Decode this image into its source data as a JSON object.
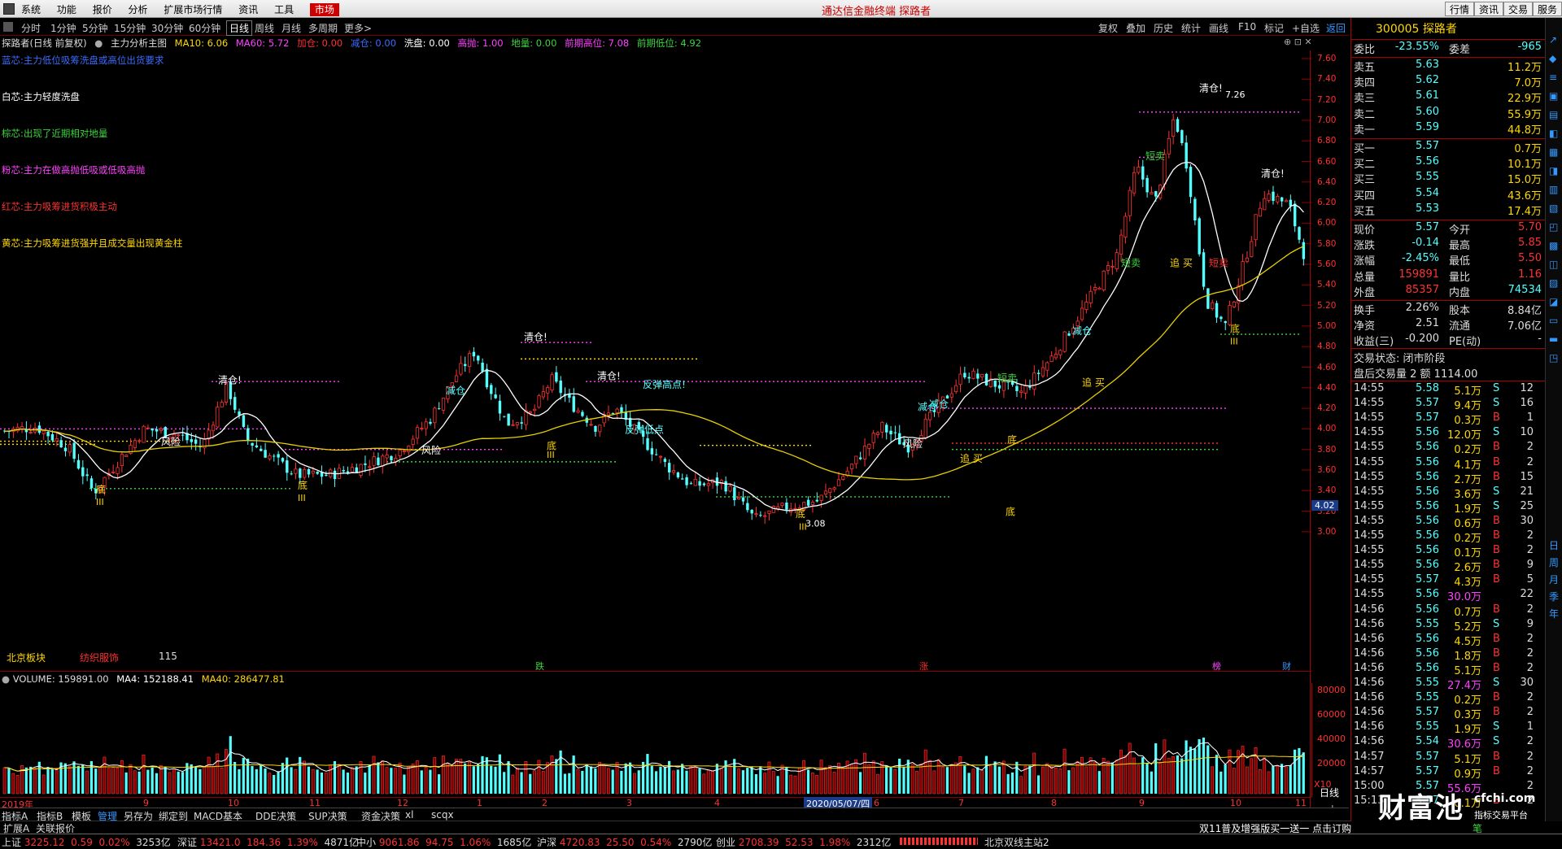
{
  "titlebar": {
    "menu": [
      "系统",
      "功能",
      "报价",
      "分析",
      "扩展市场行情",
      "资讯",
      "工具",
      "市场"
    ],
    "center_title": "通达信金融终端 探路者",
    "right_buttons": [
      "行情",
      "资讯",
      "交易",
      "服务"
    ]
  },
  "toolbar": {
    "periods": [
      "分时",
      "1分钟",
      "5分钟",
      "15分钟",
      "30分钟",
      "60分钟",
      "日线",
      "周线",
      "月线",
      "多周期",
      "更多>"
    ],
    "active_period": "日线",
    "right_tools": [
      "复权",
      "叠加",
      "历史",
      "统计",
      "画线",
      "F10",
      "标记",
      "+自选",
      "返回"
    ]
  },
  "infoline": {
    "stock": "探路者(日线 前复权)",
    "indicator": "主力分析主图",
    "ma10": "MA10: 6.06",
    "ma60": "MA60: 5.72",
    "jiacang": "加仓: 0.00",
    "jiancang": "减仓: 0.00",
    "xipan": "洗盘: 0.00",
    "gaopao": "高抛: 1.00",
    "diliang": "地量: 0.00",
    "prev_high": "前期高位: 7.08",
    "prev_low": "前期低位: 4.92"
  },
  "legend": [
    {
      "text": "蓝芯:主力低位吸筹洗盘或高位出货要求",
      "color": "#3a6bff"
    },
    {
      "text": "白芯:主力轻度洗盘",
      "color": "#ffffff"
    },
    {
      "text": "棕芯:出现了近期相对地量",
      "color": "#3cd43c"
    },
    {
      "text": "粉芯:主力在做高抛低吸或低吸高抛",
      "color": "#ff40ff"
    },
    {
      "text": "红芯:主力吸筹进货积极主动",
      "color": "#ff3030"
    },
    {
      "text": "黄芯:主力吸筹进货强并且成交量出现黄金柱",
      "color": "#ffd800"
    }
  ],
  "chart_axis": {
    "price_ticks": [
      "7.60",
      "7.40",
      "7.20",
      "7.00",
      "6.80",
      "6.60",
      "6.40",
      "6.20",
      "6.00",
      "5.80",
      "5.60",
      "5.40",
      "5.20",
      "5.00",
      "4.80",
      "4.60",
      "4.40",
      "4.20",
      "4.00",
      "3.80",
      "3.60",
      "3.40",
      "3.20",
      "3.00"
    ],
    "current_price_tag": "4.02",
    "volume_ticks": [
      "80000",
      "60000",
      "40000",
      "20000",
      "X10"
    ],
    "month_labels": [
      "2019年",
      "9",
      "10",
      "11",
      "12",
      "1",
      "2",
      "3",
      "4",
      "5",
      "6",
      "7",
      "8",
      "9",
      "10",
      "11"
    ],
    "date_tag": "2020/05/07/四"
  },
  "chart_annotations": {
    "qingcang": [
      "清仓!",
      "清仓!",
      "清仓!",
      "清仓!",
      "清仓!"
    ],
    "high_label": "7.26",
    "low_label": "3.08",
    "di": [
      "底",
      "底",
      "底",
      "底",
      "底",
      "底",
      "底"
    ],
    "fanfeng": [
      "反弹高点!",
      "反弹低点"
    ],
    "jiancang": [
      "减仓",
      "减仓",
      "减仓",
      "减仓"
    ],
    "fengxian": [
      "风险",
      "风险",
      "风险"
    ],
    "zhuimai": [
      "追 买",
      "追 买",
      "追 买"
    ],
    "duanmai": [
      "短卖",
      "短卖",
      "短卖",
      "短卖"
    ],
    "roman": [
      "III",
      "III",
      "III",
      "III",
      "III"
    ]
  },
  "event_markers": [
    "跌",
    "涨",
    "榜",
    "财"
  ],
  "sector_row": {
    "a": "北京板块",
    "b": "纺织服饰",
    "c": "115"
  },
  "volume_line": {
    "title": "VOLUME: 159891.00",
    "ma4": "MA4: 152188.41",
    "ma40": "MA40: 286477.81"
  },
  "bottom_tabs": [
    "指标A",
    "指标B",
    "模板",
    "管理",
    "另存为",
    "绑定到",
    "MACD基本",
    "DDE决策",
    "SUP决策",
    "资金决策",
    "xl",
    "scqx"
  ],
  "active_tab": "管理",
  "expand_row": [
    "扩展A",
    "关联报价"
  ],
  "right_panel": {
    "code_name": "300005 探路者",
    "weibi": {
      "label": "委比",
      "val": "-23.55%",
      "label2": "委差",
      "val2": "-965"
    },
    "asks": [
      {
        "label": "卖五",
        "price": "5.63",
        "vol": "11.2万"
      },
      {
        "label": "卖四",
        "price": "5.62",
        "vol": "7.0万"
      },
      {
        "label": "卖三",
        "price": "5.61",
        "vol": "22.9万"
      },
      {
        "label": "卖二",
        "price": "5.60",
        "vol": "55.9万"
      },
      {
        "label": "卖一",
        "price": "5.59",
        "vol": "44.8万"
      }
    ],
    "bids": [
      {
        "label": "买一",
        "price": "5.57",
        "vol": "0.7万"
      },
      {
        "label": "买二",
        "price": "5.56",
        "vol": "10.1万"
      },
      {
        "label": "买三",
        "price": "5.55",
        "vol": "15.0万"
      },
      {
        "label": "买四",
        "price": "5.54",
        "vol": "43.6万"
      },
      {
        "label": "买五",
        "price": "5.53",
        "vol": "17.4万"
      }
    ],
    "stats": [
      {
        "l1": "现价",
        "v1": "5.57",
        "l2": "今开",
        "v2": "5.70"
      },
      {
        "l1": "涨跌",
        "v1": "-0.14",
        "l2": "最高",
        "v2": "5.85"
      },
      {
        "l1": "涨幅",
        "v1": "-2.45%",
        "l2": "最低",
        "v2": "5.50"
      },
      {
        "l1": "总量",
        "v1": "159891",
        "l2": "量比",
        "v2": "1.16"
      },
      {
        "l1": "外盘",
        "v1": "85357",
        "l2": "内盘",
        "v2": "74534"
      },
      {
        "l1": "换手",
        "v1": "2.26%",
        "l2": "股本",
        "v2": "8.84亿"
      },
      {
        "l1": "净资",
        "v1": "2.51",
        "l2": "流通",
        "v2": "7.06亿"
      },
      {
        "l1": "收益(三)",
        "v1": "-0.200",
        "l2": "PE(动)",
        "v2": "-"
      }
    ],
    "status": "交易状态: 闭市阶段",
    "after_hours": "盘后交易量 2 额 1114.00",
    "ticks": [
      {
        "t": "14:55",
        "p": "5.58",
        "v": "5.1万",
        "d": "S",
        "n": "12"
      },
      {
        "t": "14:55",
        "p": "5.57",
        "v": "9.4万",
        "d": "S",
        "n": "16"
      },
      {
        "t": "14:55",
        "p": "5.57",
        "v": "0.3万",
        "d": "B",
        "n": "1"
      },
      {
        "t": "14:55",
        "p": "5.56",
        "v": "12.0万",
        "d": "S",
        "n": "10"
      },
      {
        "t": "14:55",
        "p": "5.56",
        "v": "0.2万",
        "d": "B",
        "n": "2"
      },
      {
        "t": "14:55",
        "p": "5.56",
        "v": "4.1万",
        "d": "B",
        "n": "2"
      },
      {
        "t": "14:55",
        "p": "5.56",
        "v": "2.7万",
        "d": "B",
        "n": "15"
      },
      {
        "t": "14:55",
        "p": "5.56",
        "v": "3.6万",
        "d": "S",
        "n": "21"
      },
      {
        "t": "14:55",
        "p": "5.56",
        "v": "1.9万",
        "d": "S",
        "n": "25"
      },
      {
        "t": "14:55",
        "p": "5.56",
        "v": "0.6万",
        "d": "B",
        "n": "30"
      },
      {
        "t": "14:55",
        "p": "5.56",
        "v": "0.2万",
        "d": "B",
        "n": "2"
      },
      {
        "t": "14:55",
        "p": "5.56",
        "v": "0.1万",
        "d": "B",
        "n": "2"
      },
      {
        "t": "14:55",
        "p": "5.56",
        "v": "2.6万",
        "d": "B",
        "n": "9"
      },
      {
        "t": "14:55",
        "p": "5.57",
        "v": "4.3万",
        "d": "B",
        "n": "5"
      },
      {
        "t": "14:55",
        "p": "5.56",
        "v": "30.0万",
        "d": "",
        "n": "22"
      },
      {
        "t": "14:56",
        "p": "5.56",
        "v": "0.7万",
        "d": "B",
        "n": "2"
      },
      {
        "t": "14:56",
        "p": "5.55",
        "v": "5.2万",
        "d": "S",
        "n": "9"
      },
      {
        "t": "14:56",
        "p": "5.56",
        "v": "4.5万",
        "d": "B",
        "n": "2"
      },
      {
        "t": "14:56",
        "p": "5.56",
        "v": "1.8万",
        "d": "B",
        "n": "2"
      },
      {
        "t": "14:56",
        "p": "5.56",
        "v": "5.1万",
        "d": "B",
        "n": "2"
      },
      {
        "t": "14:56",
        "p": "5.55",
        "v": "27.4万",
        "d": "S",
        "n": "30"
      },
      {
        "t": "14:56",
        "p": "5.55",
        "v": "0.2万",
        "d": "B",
        "n": "2"
      },
      {
        "t": "14:56",
        "p": "5.57",
        "v": "0.3万",
        "d": "B",
        "n": "2"
      },
      {
        "t": "14:56",
        "p": "5.55",
        "v": "1.9万",
        "d": "S",
        "n": "1"
      },
      {
        "t": "14:56",
        "p": "5.54",
        "v": "30.6万",
        "d": "S",
        "n": "2"
      },
      {
        "t": "14:57",
        "p": "5.57",
        "v": "5.1万",
        "d": "B",
        "n": "2"
      },
      {
        "t": "14:57",
        "p": "5.57",
        "v": "0.9万",
        "d": "B",
        "n": "2"
      },
      {
        "t": "15:00",
        "p": "5.57",
        "v": "55.6万",
        "d": "",
        "n": "2"
      },
      {
        "t": "15:13",
        "p": "5.57",
        "v": "0.1万",
        "d": "B",
        "n": "2"
      }
    ],
    "side_icons": [
      "日",
      "周",
      "月",
      "季",
      "年"
    ],
    "side_tag": "笔",
    "ad_tag": "指标交易平台"
  },
  "bottom_status": {
    "sh": {
      "label": "上证",
      "value": "3225.12",
      "change": "0.59",
      "pct": "0.02%",
      "amount": "3253亿"
    },
    "sz": {
      "label": "深证",
      "value": "13421.0",
      "change": "184.36",
      "pct": "1.39%",
      "amount": "4871亿"
    },
    "zx": {
      "label": "中小",
      "value": "9061.86",
      "change": "94.75",
      "pct": "1.06%",
      "amount": "1685亿"
    },
    "hs": {
      "label": "沪深",
      "value": "4720.83",
      "change": "25.50",
      "pct": "0.54%",
      "amount": "2790亿"
    },
    "cy": {
      "label": "创业",
      "value": "2708.39",
      "change": "52.53",
      "pct": "1.98%",
      "amount": "2312亿"
    },
    "news": "双11普及增强版买一送一 点击订购",
    "server": "北京双线主站2"
  },
  "watermark": "财富池",
  "watermark_url": "cfchi.com",
  "colors": {
    "up": "#ff3232",
    "down": "#54ffff",
    "grid_red": "#8b0000",
    "ma10": "#ffffff",
    "ma60": "#ffd800"
  }
}
